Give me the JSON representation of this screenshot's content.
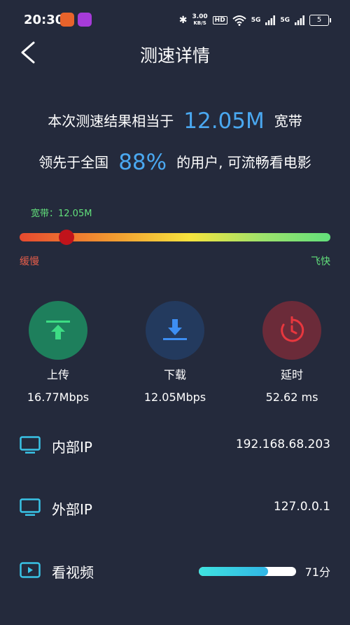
{
  "status_bar": {
    "time": "20:30",
    "net_speed_value": "3.00",
    "net_speed_unit": "KB/S",
    "hd_label": "HD",
    "signal1": "5G",
    "signal2": "5G",
    "battery": "5"
  },
  "header": {
    "title": "测速详情"
  },
  "summary": {
    "line1_prefix": "本次测速结果相当于",
    "line1_value": "12.05M",
    "line1_suffix": "宽带",
    "line2_prefix": "领先于全国",
    "line2_value": "88%",
    "line2_suffix": "的用户, 可流畅看电影"
  },
  "bandwidth": {
    "label": "宽带：12.05M",
    "slow_label": "缓慢",
    "fast_label": "飞快",
    "level_fraction": 0.15
  },
  "metrics": [
    {
      "label": "上传",
      "value": "16.77Mbps",
      "icon": "upload-icon",
      "bg": "#1e7f5c",
      "color": "#3ddc84"
    },
    {
      "label": "下载",
      "value": "12.05Mbps",
      "icon": "download-icon",
      "bg": "#233a5e",
      "color": "#3d8ef2"
    },
    {
      "label": "延时",
      "value": "52.62 ms",
      "icon": "timer-icon",
      "bg": "#6b2b39",
      "color": "#e8373e"
    }
  ],
  "info": {
    "internal_ip_label": "内部IP",
    "internal_ip_value": "192.168.68.203",
    "external_ip_label": "外部IP",
    "external_ip_value": "127.0.0.1",
    "video_label": "看视频",
    "video_score": "71分",
    "video_progress": 0.71
  },
  "colors": {
    "background": "#242a3c",
    "accent_blue": "#4aa8f0",
    "accent_green": "#62e07b",
    "accent_red": "#e45d4a",
    "icon_cyan": "#39c3e6"
  }
}
